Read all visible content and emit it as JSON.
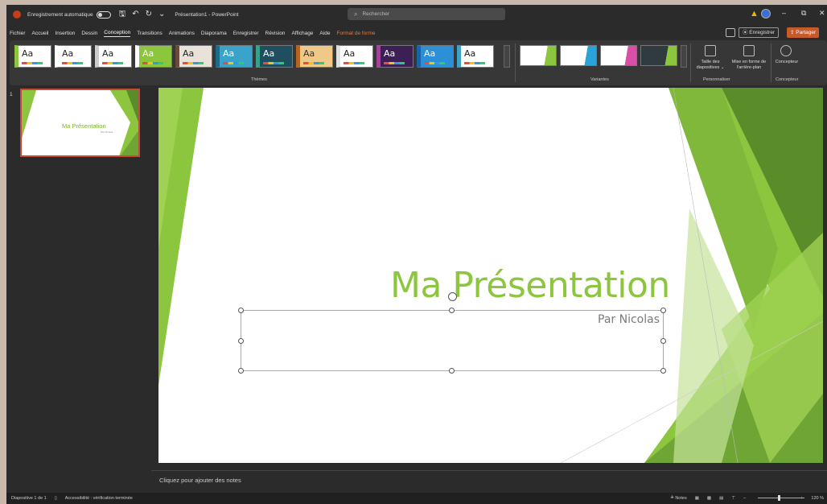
{
  "titlebar": {
    "autosave_label": "Enregistrement automatique",
    "doc_title": "Présentation1 - PowerPoint",
    "search_placeholder": "Rechercher",
    "min_glyph": "–",
    "max_glyph": "⧉",
    "close_glyph": "✕"
  },
  "tabs": [
    {
      "label": "Fichier"
    },
    {
      "label": "Accueil"
    },
    {
      "label": "Insertion"
    },
    {
      "label": "Dessin"
    },
    {
      "label": "Conception"
    },
    {
      "label": "Transitions"
    },
    {
      "label": "Animations"
    },
    {
      "label": "Diaporama"
    },
    {
      "label": "Enregistrer"
    },
    {
      "label": "Révision"
    },
    {
      "label": "Affichage"
    },
    {
      "label": "Aide"
    },
    {
      "label": "Format de forme"
    }
  ],
  "actions": {
    "save_label": "⦿ Enregistrer",
    "share_label": "⇪ Partager"
  },
  "ribbon": {
    "themes_label": "Thèmes",
    "variants_label": "Variantes",
    "personalize_label": "Personnaliser",
    "designer_group_label": "Concepteur",
    "slide_size_label": "Taille des diapositives ⌄",
    "format_bg_label": "Mise en forme de l'arrière-plan",
    "designer_label": "Concepteur",
    "theme_tiles": [
      {
        "aa": "Aa",
        "bg": "#ffffff",
        "fg": "#222222",
        "accent": "#8cc63f"
      },
      {
        "aa": "Aa",
        "bg": "#ffffff",
        "fg": "#222222",
        "accent": "#ffffff"
      },
      {
        "aa": "Aa",
        "bg": "#ffffff",
        "fg": "#222222",
        "accent": "#cccccc"
      },
      {
        "aa": "Aa",
        "bg": "#8cc63f",
        "fg": "#ffffff",
        "accent": "#ffffff"
      },
      {
        "aa": "Aa",
        "bg": "#e9e2d8",
        "fg": "#222222",
        "accent": "#6a4a3a"
      },
      {
        "aa": "Aa",
        "bg": "#3aa3c9",
        "fg": "#ffffff",
        "accent": "#1b6c8a"
      },
      {
        "aa": "Aa",
        "bg": "#1f4e5f",
        "fg": "#ffffff",
        "accent": "#35a38b"
      },
      {
        "aa": "Aa",
        "bg": "#f0c888",
        "fg": "#333333",
        "accent": "#b5651d"
      },
      {
        "aa": "Aa",
        "bg": "#ffffff",
        "fg": "#222222",
        "accent": "#e0e0e0"
      },
      {
        "aa": "Aa",
        "bg": "#3b1f55",
        "fg": "#ffffff",
        "accent": "#a3429b"
      },
      {
        "aa": "Aa",
        "bg": "#2d8fd5",
        "fg": "#ffffff",
        "accent": "#1565a8"
      },
      {
        "aa": "Aa",
        "bg": "#ffffff",
        "fg": "#222222",
        "accent": "#3aa3c9"
      }
    ],
    "variant_tiles": [
      {
        "bg": "#ffffff",
        "accent": "#8cc63f"
      },
      {
        "bg": "#ffffff",
        "accent": "#2aa3d8"
      },
      {
        "bg": "#ffffff",
        "accent": "#d84fa6"
      },
      {
        "bg": "#2f3b3f",
        "accent": "#8cc63f"
      }
    ]
  },
  "thumbnail": {
    "number": "1",
    "title": "Ma Présentation",
    "subtitle": "Par Nicolas"
  },
  "slide": {
    "title": "Ma Présentation",
    "subtitle": "Par Nicolas"
  },
  "notes": {
    "placeholder": "Cliquez pour ajouter des notes"
  },
  "status": {
    "slide_info": "Diapositive 1 de 1",
    "accessibility": "Accessibilité : vérification terminée",
    "notes_label": "≜ Notes",
    "zoom": "120 %"
  },
  "colors": {
    "accent_green": "#8cc63f",
    "dark_green": "#5a8c2a",
    "share_orange": "#c55a2b",
    "contextual_tab": "#e07b48"
  }
}
